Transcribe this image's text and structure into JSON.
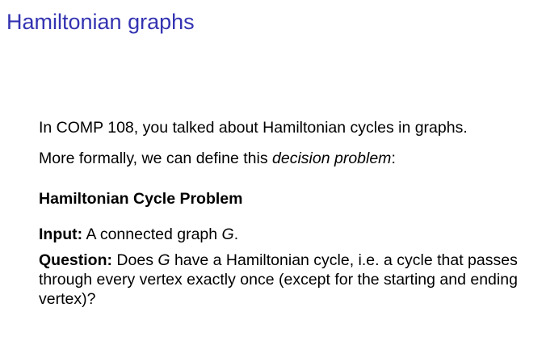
{
  "slide": {
    "title": "Hamiltonian graphs",
    "intro": "In COMP 108, you talked about Hamiltonian cycles in graphs.",
    "formal_prefix": "More formally, we can define this ",
    "formal_term": "decision problem",
    "formal_suffix": ":",
    "problem_name": "Hamiltonian Cycle Problem",
    "input_label": "Input:",
    "input_text_pre": " A connected graph ",
    "input_var": "G",
    "input_text_post": ".",
    "question_label": "Question:",
    "question_pre": " Does ",
    "question_var": "G",
    "question_post": " have a Hamiltonian cycle, i.e. a cycle that passes through every vertex exactly once (except for the starting and ending vertex)?"
  },
  "colors": {
    "title": "#3333b2",
    "text": "#000000",
    "background": "#ffffff"
  }
}
